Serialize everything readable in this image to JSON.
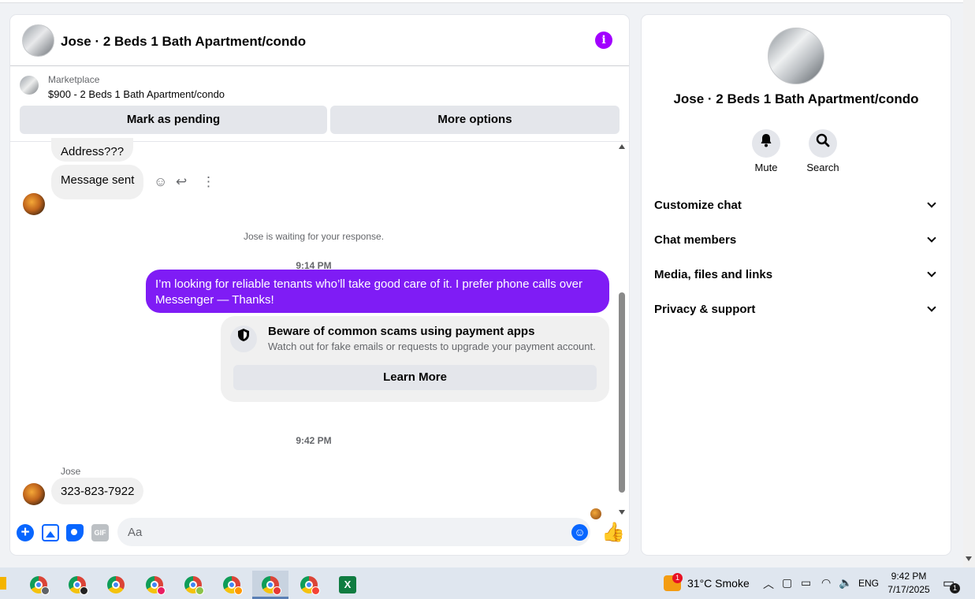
{
  "header": {
    "title": "Jose · 2 Beds 1 Bath Apartment/condo"
  },
  "marketplace": {
    "label": "Marketplace",
    "listing": "$900 - 2 Beds 1 Bath Apartment/condo",
    "pending_button": "Mark as pending",
    "options_button": "More options"
  },
  "messages": {
    "address": "Address???",
    "sent": "Message sent",
    "waiting": "Jose is waiting for your response.",
    "time1": "9:14 PM",
    "outgoing": "I’m looking for reliable tenants who’ll take good care of it. I prefer phone calls over Messenger —  Thanks!",
    "scam_title": "Beware of common scams using payment apps",
    "scam_sub": "Watch out for fake emails or requests to upgrade your payment account.",
    "learn_more": "Learn More",
    "time2": "9:42 PM",
    "sender": "Jose",
    "phone": "323-823-7922"
  },
  "composer": {
    "placeholder": "Aa",
    "gif": "GIF"
  },
  "info": {
    "title": "Jose · 2 Beds 1 Bath Apartment/condo",
    "mute": "Mute",
    "search": "Search",
    "menu": [
      "Customize chat",
      "Chat members",
      "Media, files and links",
      "Privacy & support"
    ]
  },
  "taskbar": {
    "weather_badge": "1",
    "weather": "31°C  Smoke",
    "lang": "ENG",
    "time": "9:42 PM",
    "date": "7/17/2025",
    "notifications": "1",
    "excel": "X"
  },
  "colors": {
    "accent": "#0866ff",
    "outgoing_bubble": "#7f1cf5",
    "info_icon": "#a200ff"
  },
  "icons": [
    "info-icon",
    "emoji-react-icon",
    "reply-icon",
    "more-icon",
    "shield-icon",
    "plus-icon",
    "photo-icon",
    "sticker-icon",
    "gif-icon",
    "emoji-icon",
    "like-icon",
    "bell-icon",
    "search-icon",
    "chevron-down-icon"
  ]
}
